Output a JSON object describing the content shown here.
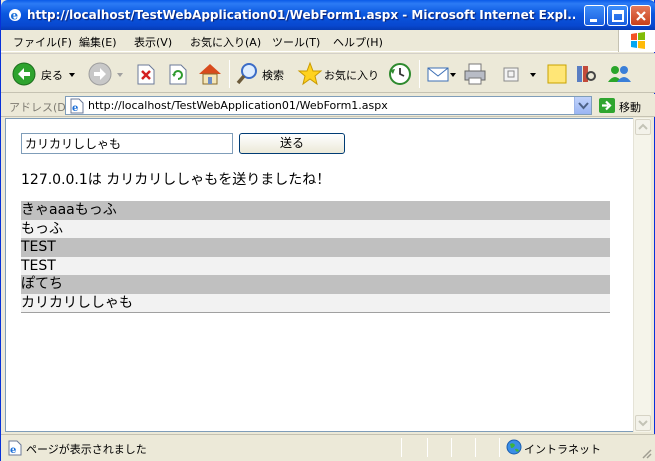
{
  "window": {
    "title": "http://localhost/TestWebApplication01/WebForm1.aspx - Microsoft Internet Expl..."
  },
  "menu": [
    "ファイル(F)",
    "編集(E)",
    "表示(V)",
    "お気に入り(A)",
    "ツール(T)",
    "ヘルプ(H)"
  ],
  "toolbar": {
    "back_label": "戻る",
    "search_label": "検索",
    "favorites_label": "お気に入り"
  },
  "address": {
    "label": "アドレス(D)",
    "url": "http://localhost/TestWebApplication01/WebForm1.aspx",
    "go_label": "移動"
  },
  "form": {
    "input_value": "カリカリししゃも",
    "send_label": "送る",
    "message": "127.0.0.1は カリカリししゃもを送りましたね！"
  },
  "list": [
    "きゃaaaもっふ",
    "もっふ",
    "TEST",
    "TEST",
    "ぽてち",
    "カリカリししゃも"
  ],
  "status": {
    "text": "ページが表示されました",
    "zone": "イントラネット"
  },
  "colors": {
    "titlebar": "#0a5ae8",
    "row_alt": "#c0c0c0",
    "row_plain": "#f2f2f2"
  },
  "icons": [
    "ie-icon",
    "minimize-icon",
    "maximize-icon",
    "close-icon",
    "windows-logo-icon",
    "back-arrow-icon",
    "forward-arrow-icon",
    "stop-icon",
    "refresh-icon",
    "home-icon",
    "search-icon",
    "favorites-star-icon",
    "history-icon",
    "mail-icon",
    "print-icon",
    "edit-icon",
    "discuss-icon",
    "research-icon",
    "messenger-icon",
    "page-icon",
    "go-arrow-icon",
    "status-page-icon",
    "intranet-icon"
  ]
}
